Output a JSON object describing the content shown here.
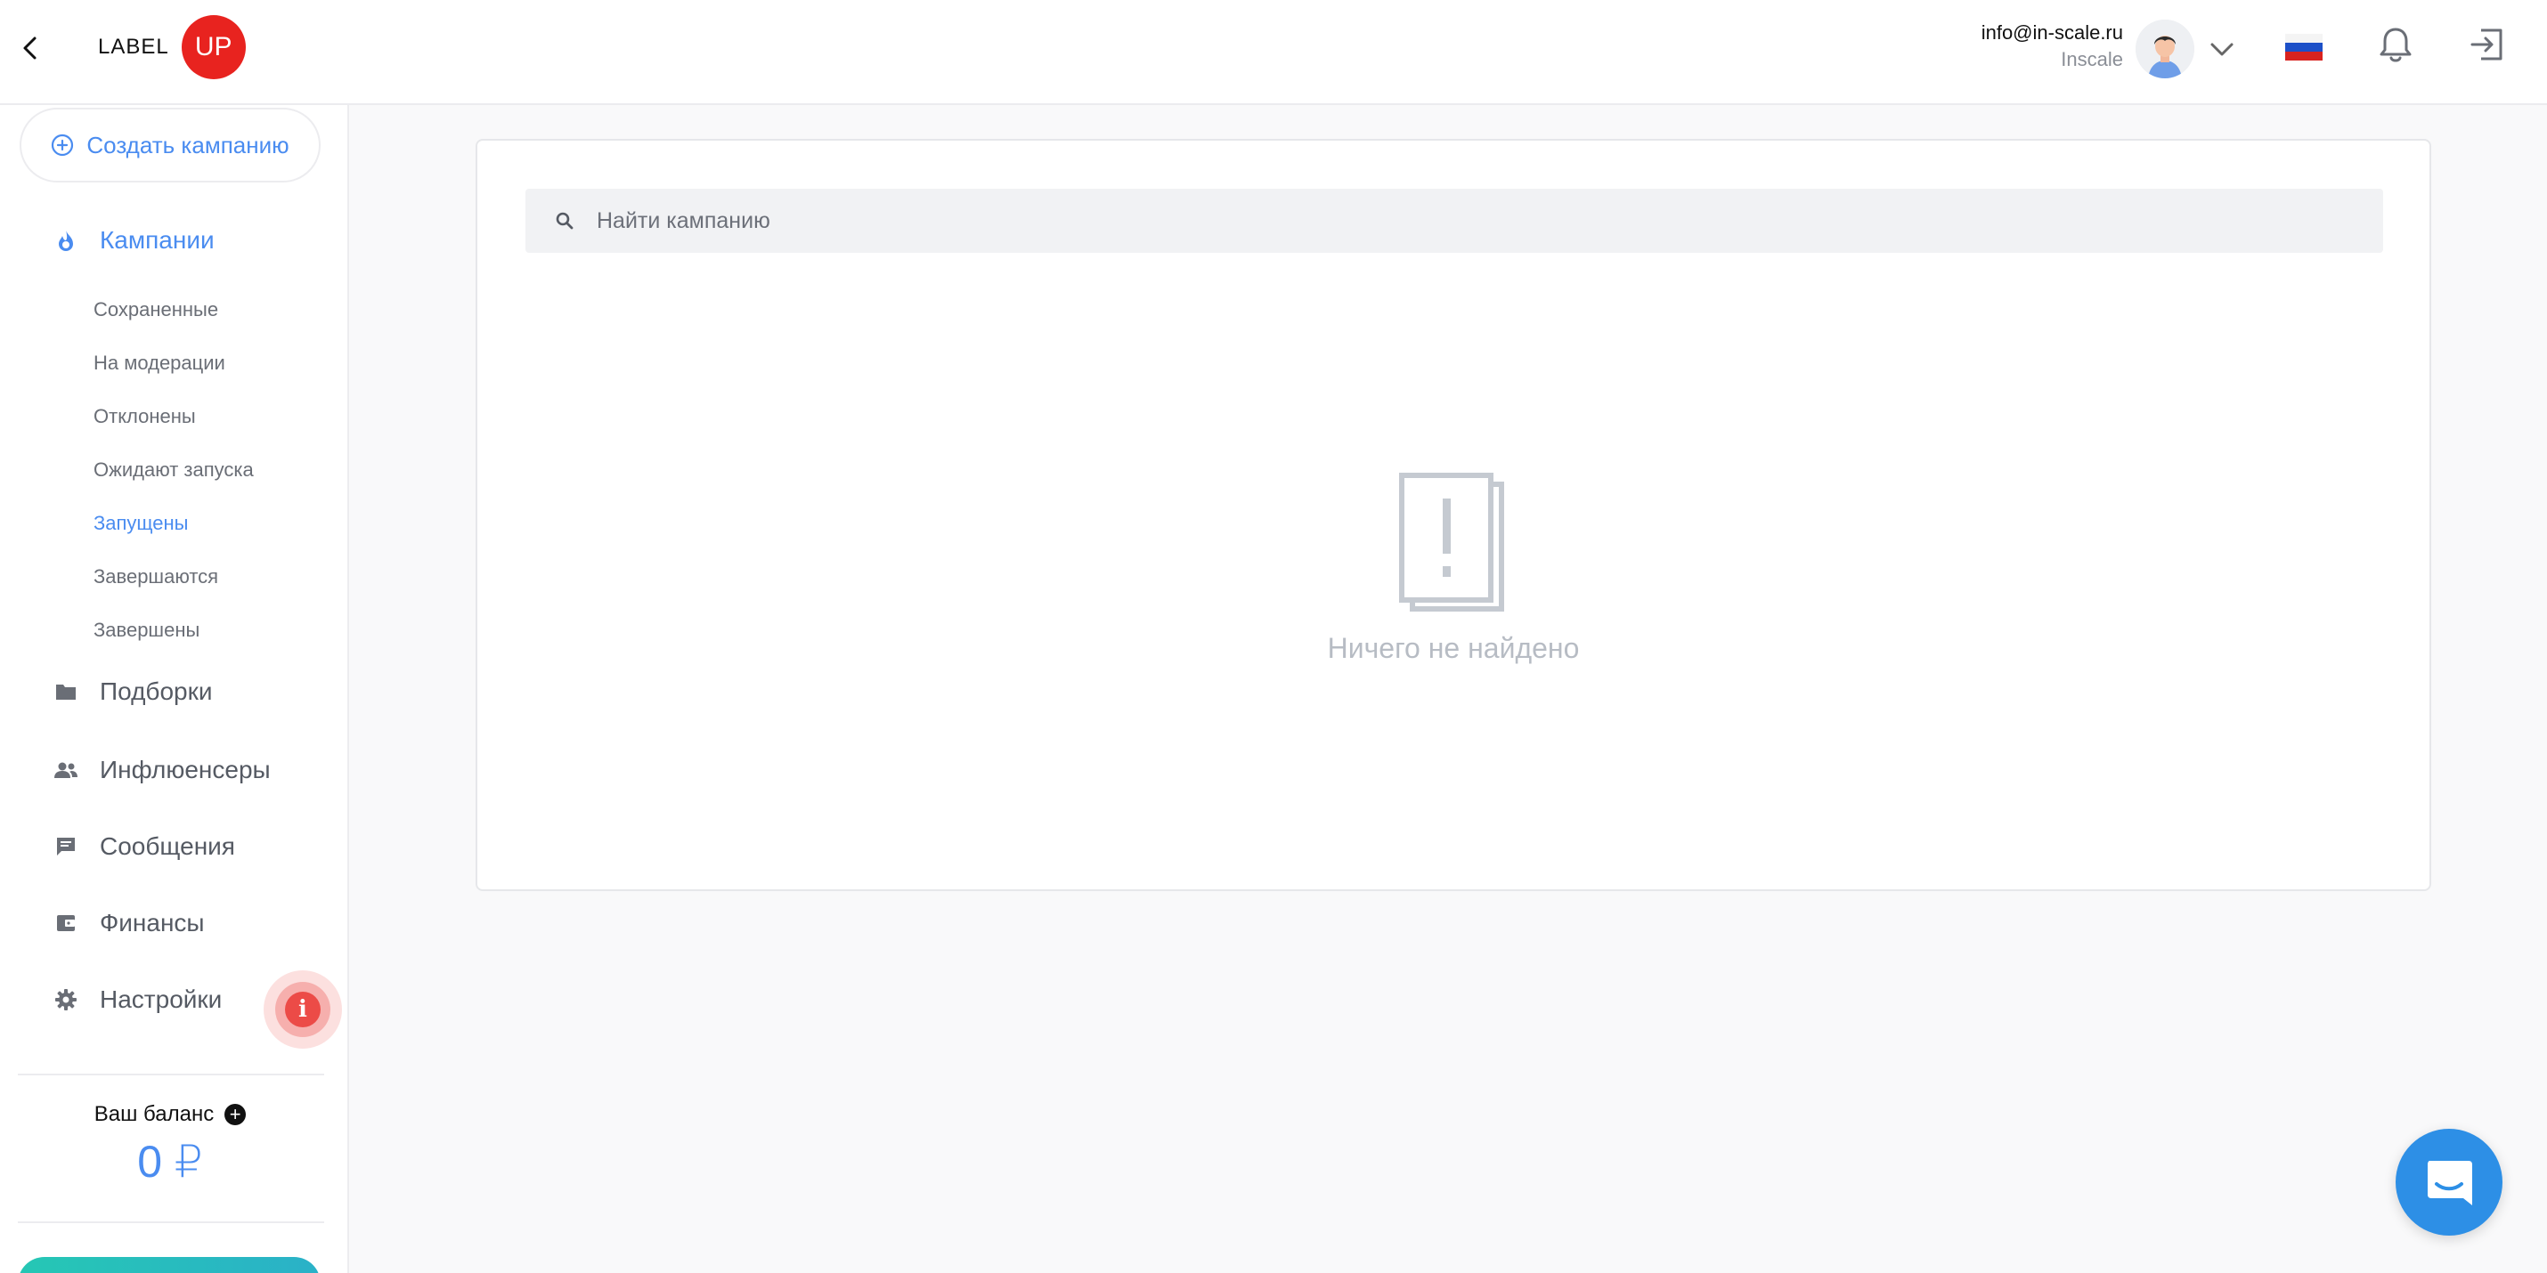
{
  "header": {
    "logo_text": "LABEL",
    "logo_badge": "UP",
    "user_email": "info@in-scale.ru",
    "user_company": "Inscale",
    "language_flag": "ru-flag-icon"
  },
  "sidebar": {
    "create_campaign_label": "Создать кампанию",
    "main_items": [
      {
        "label": "Кампании",
        "icon": "flame-icon",
        "active": true
      },
      {
        "label": "Подборки",
        "icon": "folder-icon",
        "active": false
      },
      {
        "label": "Инфлюенсеры",
        "icon": "people-icon",
        "active": false
      },
      {
        "label": "Сообщения",
        "icon": "chat-bubble-icon",
        "active": false
      },
      {
        "label": "Финансы",
        "icon": "wallet-icon",
        "active": false
      },
      {
        "label": "Настройки",
        "icon": "gear-icon",
        "active": false
      }
    ],
    "campaign_subitems": [
      {
        "label": "Сохраненные",
        "active": false
      },
      {
        "label": "На модерации",
        "active": false
      },
      {
        "label": "Отклонены",
        "active": false
      },
      {
        "label": "Ожидают запуска",
        "active": false
      },
      {
        "label": "Запущены",
        "active": true
      },
      {
        "label": "Завершаются",
        "active": false
      },
      {
        "label": "Завершены",
        "active": false
      }
    ],
    "balance_label": "Ваш баланс",
    "balance_value": "0 ₽"
  },
  "main": {
    "search_placeholder": "Найти кампанию",
    "empty_state_text": "Ничего не найдено"
  },
  "colors": {
    "accent": "#4a8cf0",
    "brand_red": "#e8231f",
    "alert_red": "#ec4b47",
    "chat_blue": "#2d8fe6"
  }
}
